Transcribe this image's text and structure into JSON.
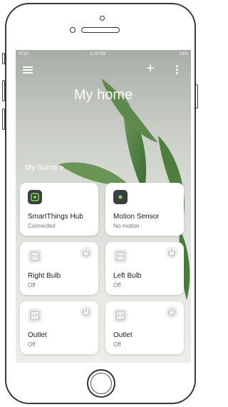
{
  "status_bar": {
    "carrier": "AT&T",
    "time": "3:29 PM",
    "battery": "24%"
  },
  "header": {
    "add_icon": "plus-icon",
    "menu_icon": "hamburger-icon",
    "more_icon": "vertical-dots-icon"
  },
  "page": {
    "title": "My home",
    "breadcrumb": "My home >"
  },
  "devices": [
    {
      "name": "SmartThings Hub",
      "status": "Connected",
      "icon": "hub-icon",
      "icon_color": "#3c3f3f",
      "accent": "#7ed957"
    },
    {
      "name": "Motion Sensor",
      "status": "No motion",
      "icon": "motion-sensor-icon",
      "icon_color": "#3c3f3f",
      "accent": "#7ed957"
    },
    {
      "name": "Right Bulb",
      "status": "Off",
      "icon": "outlet-icon",
      "power_icon": "power-icon"
    },
    {
      "name": "Left Bulb",
      "status": "Off",
      "icon": "outlet-icon",
      "power_icon": "power-icon"
    },
    {
      "name": "Outlet",
      "status": "Off",
      "icon": "outlet-icon",
      "power_icon": "power-icon"
    },
    {
      "name": "Outlet",
      "status": "Off",
      "icon": "outlet-icon",
      "power_icon": "power-icon"
    }
  ]
}
